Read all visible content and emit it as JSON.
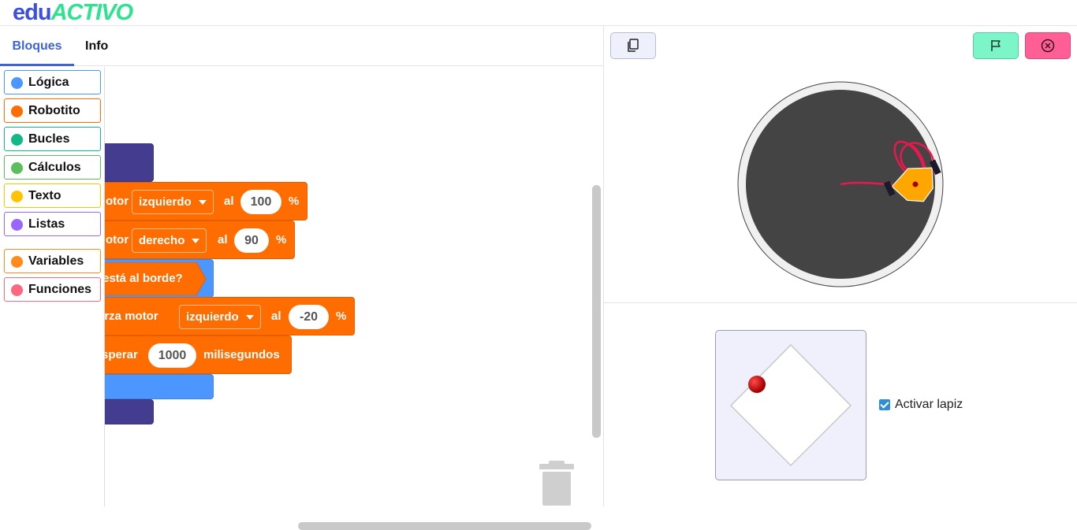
{
  "app": {
    "logo_edu": "edu",
    "logo_activo": "ACTIVO"
  },
  "tabs": [
    {
      "label": "Bloques",
      "active": true
    },
    {
      "label": "Info",
      "active": false
    }
  ],
  "toolbox": {
    "categories": [
      {
        "label": "Lógica",
        "color": "#4c97ff"
      },
      {
        "label": "Robotito",
        "color": "#ff6d00"
      },
      {
        "label": "Bucles",
        "color": "#12b886"
      },
      {
        "label": "Cálculos",
        "color": "#5cbe5c"
      },
      {
        "label": "Texto",
        "color": "#ffc400"
      },
      {
        "label": "Listas",
        "color": "#9966ff"
      },
      {
        "label": "Variables",
        "color": "#ff8c1a"
      },
      {
        "label": "Funciones",
        "color": "#ff6680"
      }
    ]
  },
  "blocks": {
    "motor_left": {
      "prefix": "otor",
      "dropdown": "izquierdo",
      "al": "al",
      "value": "100",
      "unit": "%"
    },
    "motor_right": {
      "prefix": "otor",
      "dropdown": "derecho",
      "al": "al",
      "value": "90",
      "unit": "%"
    },
    "edge_check": {
      "label": "está al borde?"
    },
    "force_motor": {
      "prefix": "erza motor",
      "dropdown": "izquierdo",
      "al": "al",
      "value": "-20",
      "unit": "%"
    },
    "wait": {
      "prefix": "sperar",
      "value": "1000",
      "suffix": "milisegundos"
    }
  },
  "right_toolbar": {
    "copy_icon": "copy-icon",
    "flag_icon": "flag-icon",
    "stop_icon": "close-circle-icon"
  },
  "simulator": {
    "pen_label": "Activar lapiz",
    "pen_checked": true
  },
  "colors": {
    "accent": "#3d63d8",
    "block_orange": "#ff6d00",
    "block_blue": "#4c97ff",
    "block_dark": "#443d8f"
  }
}
